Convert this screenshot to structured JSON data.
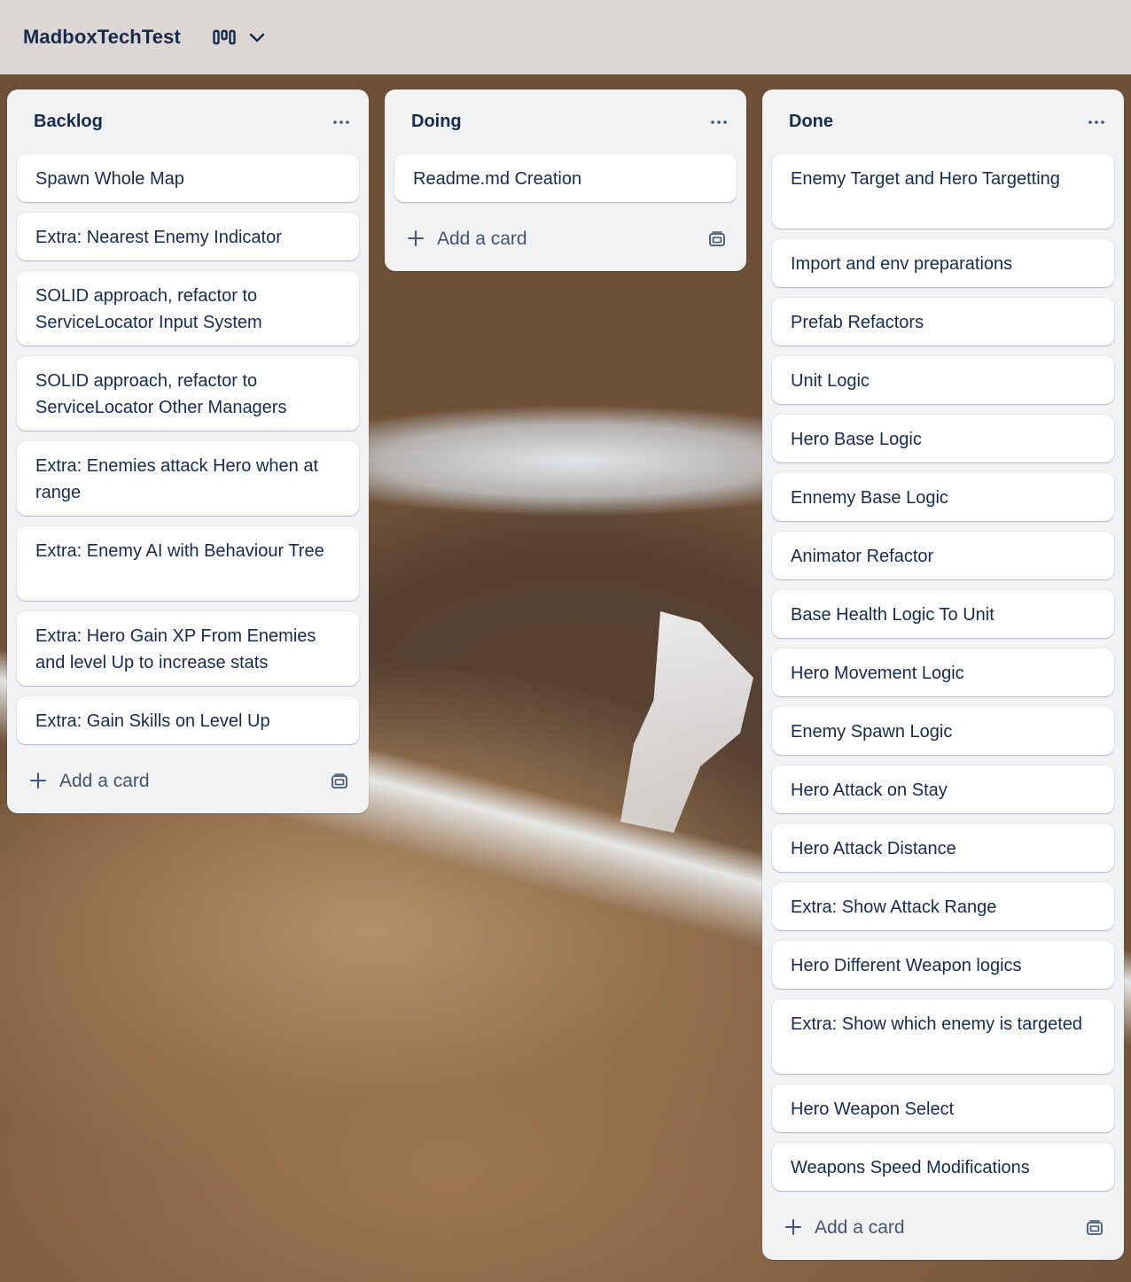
{
  "board": {
    "title": "MadboxTechTest"
  },
  "lists": [
    {
      "title": "Backlog",
      "cards": [
        "Spawn Whole Map",
        "Extra: Nearest Enemy Indicator",
        "SOLID approach, refactor to ServiceLocator Input System",
        "SOLID approach, refactor to ServiceLocator Other Managers",
        "Extra: Enemies attack Hero when at range",
        "Extra: Enemy AI with Behaviour Tree",
        "Extra: Hero Gain XP From Enemies and level Up to increase stats",
        "Extra: Gain Skills on Level Up"
      ],
      "add_card_label": "Add a card"
    },
    {
      "title": "Doing",
      "cards": [
        "Readme.md Creation"
      ],
      "add_card_label": "Add a card"
    },
    {
      "title": "Done",
      "cards": [
        "Enemy Target and Hero Targetting",
        "Import and env preparations",
        "Prefab Refactors",
        "Unit Logic",
        "Hero Base Logic",
        "Ennemy Base Logic",
        "Animator Refactor",
        "Base Health Logic To Unit",
        "Hero Movement Logic",
        "Enemy Spawn Logic",
        "Hero Attack on Stay",
        "Hero Attack Distance",
        "Extra: Show Attack Range",
        "Hero Different Weapon logics",
        "Extra: Show which enemy is targeted",
        "Hero Weapon Select",
        "Weapons Speed Modifications"
      ],
      "add_card_label": "Add a card"
    }
  ],
  "icons": {
    "view_switcher": "board-view-icon",
    "dropdown": "chevron-down-icon",
    "list_menu": "more-horizontal-icon",
    "add": "plus-icon",
    "template": "card-template-icon"
  }
}
